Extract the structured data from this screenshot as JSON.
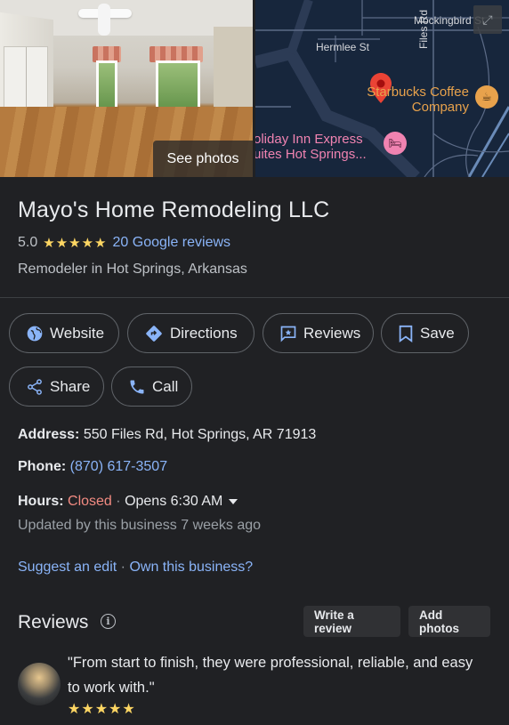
{
  "media": {
    "see_photos_label": "See photos",
    "map": {
      "streets": [
        "Mockingbird St",
        "Hermlee St",
        "Files Rd"
      ],
      "poi_starbucks": "Starbucks Coffee Company",
      "poi_starbucks_line1": "Starbucks Coffee",
      "poi_starbucks_line2": "Company",
      "poi_hotel_line1": "oliday Inn Express",
      "poi_hotel_line2": "uites Hot Springs..."
    }
  },
  "business": {
    "name": "Mayo's Home Remodeling LLC",
    "rating": "5.0",
    "stars": "★★★★★",
    "reviews_link": "20 Google reviews",
    "category": "Remodeler in Hot Springs, Arkansas"
  },
  "actions": {
    "website": "Website",
    "directions": "Directions",
    "reviews": "Reviews",
    "save": "Save",
    "share": "Share",
    "call": "Call"
  },
  "details": {
    "address_label": "Address:",
    "address_value": "550 Files Rd, Hot Springs, AR 71913",
    "phone_label": "Phone:",
    "phone_value": "(870) 617-3507",
    "hours_label": "Hours:",
    "hours_status": "Closed",
    "hours_sep": "·",
    "hours_next": "Opens 6:30 AM",
    "updated": "Updated by this business 7 weeks ago",
    "suggest_edit": "Suggest an edit",
    "edit_sep": "·",
    "own_business": "Own this business?"
  },
  "reviews_section": {
    "title": "Reviews",
    "write_review": "Write a review",
    "add_photos": "Add photos",
    "first_review": {
      "text": "\"From start to finish, they were professional, reliable, and easy to work with.\"",
      "stars": "★★★★★"
    }
  },
  "colors": {
    "background": "#202124",
    "link": "#8ab4f8",
    "star": "#fdd663",
    "closed": "#f28b82",
    "map_bg": "#17263c"
  }
}
